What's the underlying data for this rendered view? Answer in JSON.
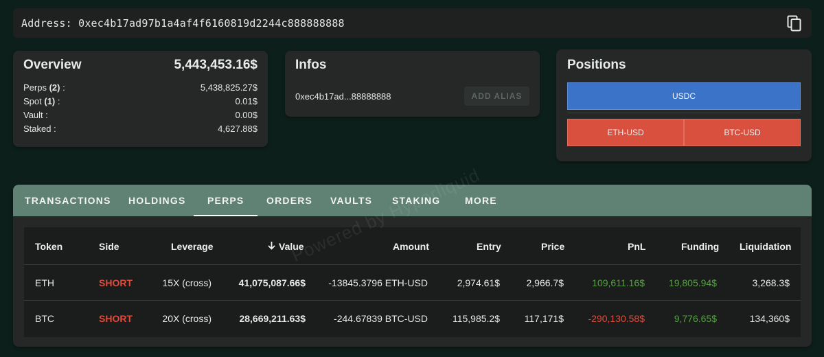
{
  "address_bar": {
    "label": "Address:",
    "value": "0xec4b17ad97b1a4af4f6160819d2244c888888888"
  },
  "overview": {
    "title": "Overview",
    "total": "5,443,453.16$",
    "rows": [
      {
        "label_pre": "Perps ",
        "count": "(2)",
        "label_post": " :",
        "value": "5,438,825.27$"
      },
      {
        "label_pre": "Spot ",
        "count": "(1)",
        "label_post": " :",
        "value": "0.01$"
      },
      {
        "label_pre": "Vault :",
        "count": "",
        "label_post": "",
        "value": "0.00$"
      },
      {
        "label_pre": "Staked :",
        "count": "",
        "label_post": "",
        "value": "4,627.88$"
      }
    ]
  },
  "infos": {
    "title": "Infos",
    "short_address": "0xec4b17ad...88888888",
    "alias_button": "ADD ALIAS"
  },
  "positions": {
    "title": "Positions",
    "long": [
      "USDC"
    ],
    "short": [
      "ETH-USD",
      "BTC-USD"
    ]
  },
  "tabs": [
    "TRANSACTIONS",
    "HOLDINGS",
    "PERPS",
    "ORDERS",
    "VAULTS",
    "STAKING",
    "MORE"
  ],
  "active_tab": "PERPS",
  "table": {
    "headers": [
      "Token",
      "Side",
      "Leverage",
      "Value",
      "Amount",
      "Entry",
      "Price",
      "PnL",
      "Funding",
      "Liquidation"
    ],
    "rows": [
      {
        "token": "ETH",
        "side": "SHORT",
        "leverage": "15X (cross)",
        "value": "41,075,087.66$",
        "amount": "-13845.3796 ETH-USD",
        "entry": "2,974.61$",
        "price": "2,966.7$",
        "pnl": "109,611.16$",
        "funding": "19,805.94$",
        "liquidation": "3,268.3$"
      },
      {
        "token": "BTC",
        "side": "SHORT",
        "leverage": "20X (cross)",
        "value": "28,669,211.63$",
        "amount": "-244.67839 BTC-USD",
        "entry": "115,985.2$",
        "price": "117,171$",
        "pnl": "-290,130.58$",
        "funding": "9,776.65$",
        "liquidation": "134,360$"
      }
    ]
  },
  "watermark": "Powered by Hyperliquid",
  "colors": {
    "background": "#0d1f1b",
    "tab_bar": "#5f8275",
    "long": "#3a73c8",
    "short": "#d9503f",
    "positive": "#56a042",
    "negative": "#e24a3a"
  }
}
